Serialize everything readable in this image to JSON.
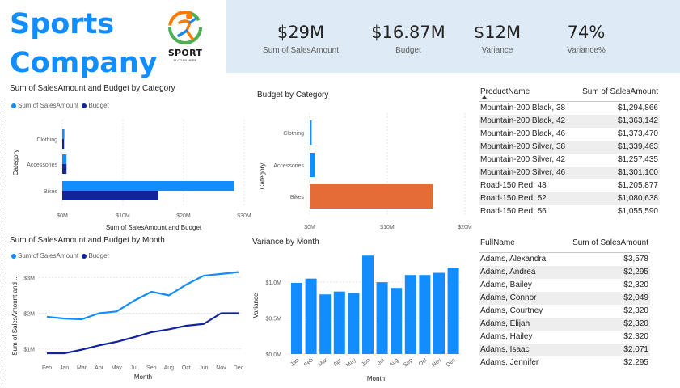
{
  "title": "Sports Company",
  "logo": {
    "text": "SPORT",
    "slogan": "SLOGAN HERE"
  },
  "colors": {
    "primary": "#118dff",
    "secondary": "#12239e",
    "highlight": "#e66c37",
    "kpi_bg": "#deebf7"
  },
  "kpis": [
    {
      "value": "$29M",
      "label": "Sum of SalesAmount"
    },
    {
      "value": "$16.87M",
      "label": "Budget"
    },
    {
      "value": "$12M",
      "label": "Variance"
    },
    {
      "value": "74%",
      "label": "Variance%"
    }
  ],
  "chart_data": [
    {
      "type": "bar",
      "orientation": "horizontal",
      "title": "Sum of SalesAmount and Budget by Category",
      "xlabel": "Sum of SalesAmount and Budget",
      "ylabel": "Category",
      "categories": [
        "Clothing",
        "Accessories",
        "Bikes"
      ],
      "series": [
        {
          "name": "Sum of SalesAmount",
          "values": [
            0.35,
            0.7,
            28.32
          ]
        },
        {
          "name": "Budget",
          "values": [
            0.3,
            0.7,
            15.87
          ]
        }
      ],
      "xlim": [
        0,
        30
      ],
      "xticks": [
        "$0M",
        "$10M",
        "$20M",
        "$30M"
      ],
      "legend": "top-left"
    },
    {
      "type": "bar",
      "orientation": "horizontal",
      "title": "Budget by Category",
      "xlabel": "Budget",
      "ylabel": "Category",
      "categories": [
        "Clothing",
        "Accessories",
        "Bikes"
      ],
      "values": [
        0.25,
        0.65,
        15.87
      ],
      "xlim": [
        0,
        20
      ],
      "xticks": [
        "$0M",
        "$10M",
        "$20M"
      ]
    },
    {
      "type": "line",
      "title": "Sum of SalesAmount and Budget by Month",
      "xlabel": "Month",
      "ylabel": "Sum of SalesAmount and ...",
      "x": [
        "Feb",
        "Jan",
        "Mar",
        "Apr",
        "May",
        "Jul",
        "Sep",
        "Aug",
        "Oct",
        "Jun",
        "Nov",
        "Dec"
      ],
      "series": [
        {
          "name": "Sum of SalesAmount",
          "values": [
            1.9,
            1.85,
            1.83,
            2.0,
            2.05,
            2.35,
            2.6,
            2.5,
            2.8,
            3.05,
            3.1,
            3.15
          ]
        },
        {
          "name": "Budget",
          "values": [
            0.88,
            0.88,
            0.98,
            1.1,
            1.2,
            1.33,
            1.47,
            1.55,
            1.65,
            1.7,
            2.0,
            2.0
          ]
        }
      ],
      "ylim": [
        0.7,
        3.3
      ],
      "yticks": [
        {
          "label": "$1M",
          "value": 1
        },
        {
          "label": "$2M",
          "value": 2
        },
        {
          "label": "$3M",
          "value": 3
        }
      ],
      "legend": "top-left"
    },
    {
      "type": "bar",
      "title": "Variance by Month",
      "xlabel": "Month",
      "ylabel": "Variance",
      "categories": [
        "Jan",
        "Feb",
        "Mar",
        "Apr",
        "May",
        "Jun",
        "Jul",
        "Aug",
        "Sep",
        "Oct",
        "Nov",
        "Dec"
      ],
      "values": [
        0.99,
        1.05,
        0.83,
        0.87,
        0.85,
        1.37,
        1.0,
        0.92,
        1.1,
        1.1,
        1.13,
        1.2
      ],
      "ylim": [
        0,
        1.35
      ],
      "yticks": [
        {
          "label": "$0.0M",
          "value": 0
        },
        {
          "label": "$0.5M",
          "value": 0.5
        },
        {
          "label": "$1.0M",
          "value": 1.0
        }
      ]
    }
  ],
  "product_table": {
    "headers": [
      "ProductName",
      "Sum of SalesAmount"
    ],
    "rows": [
      [
        "Mountain-200 Black, 38",
        "$1,294,866"
      ],
      [
        "Mountain-200 Black, 42",
        "$1,363,142"
      ],
      [
        "Mountain-200 Black, 46",
        "$1,373,470"
      ],
      [
        "Mountain-200 Silver, 38",
        "$1,339,463"
      ],
      [
        "Mountain-200 Silver, 42",
        "$1,257,435"
      ],
      [
        "Mountain-200 Silver, 46",
        "$1,301,100"
      ],
      [
        "Road-150 Red, 48",
        "$1,205,877"
      ],
      [
        "Road-150 Red, 52",
        "$1,080,638"
      ],
      [
        "Road-150 Red, 56",
        "$1,055,590"
      ]
    ]
  },
  "customer_table": {
    "headers": [
      "FullName",
      "Sum of SalesAmount"
    ],
    "rows": [
      [
        "Adams, Alexandra",
        "$3,578"
      ],
      [
        "Adams, Andrea",
        "$2,295"
      ],
      [
        "Adams, Bailey",
        "$2,320"
      ],
      [
        "Adams, Connor",
        "$2,049"
      ],
      [
        "Adams, Courtney",
        "$2,320"
      ],
      [
        "Adams, Elijah",
        "$2,320"
      ],
      [
        "Adams, Hailey",
        "$2,320"
      ],
      [
        "Adams, Isaac",
        "$2,071"
      ],
      [
        "Adams, Jennifer",
        "$2,295"
      ]
    ]
  }
}
